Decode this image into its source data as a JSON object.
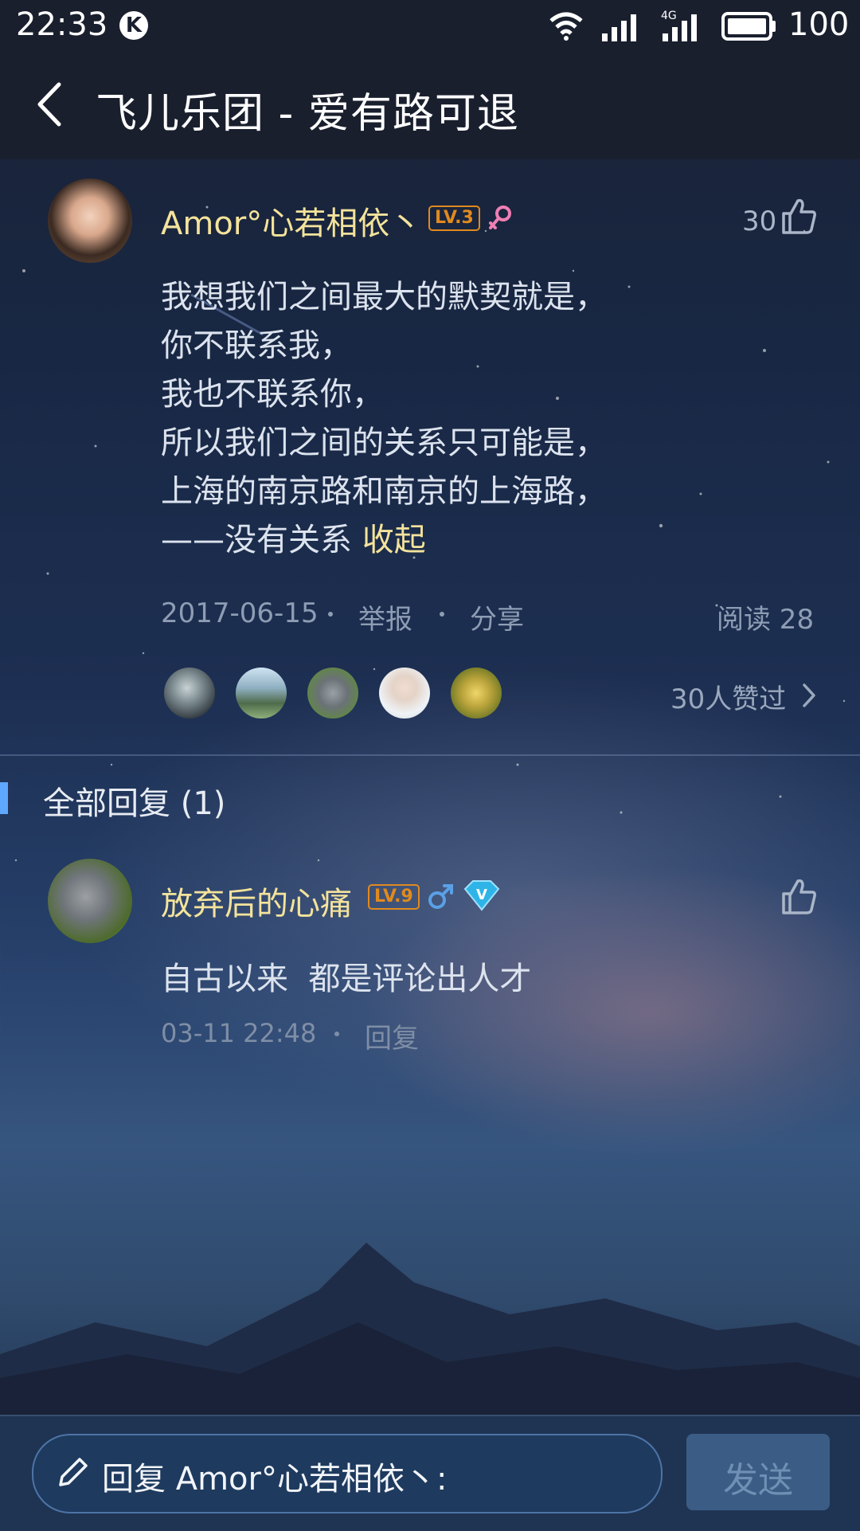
{
  "status_bar": {
    "time": "22:33",
    "app_badge": "K",
    "network": "4G",
    "battery": "100"
  },
  "header": {
    "title": "飞儿乐团 - 爱有路可退"
  },
  "post": {
    "author": "Amor°心若相依丶",
    "level": "LV.3",
    "gender_icon": "female-icon",
    "like_count": "30",
    "lines": [
      "我想我们之间最大的默契就是，",
      "你不联系我，",
      "我也不联系你，",
      "所以我们之间的关系只可能是，",
      "上海的南京路和南京的上海路，",
      "——没有关系"
    ],
    "collapse_label": "收起",
    "date": "2017-06-15",
    "report_label": "举报",
    "share_label": "分享",
    "read_label": "阅读 28",
    "likers_label": "30人赞过"
  },
  "replies": {
    "section_title": "全部回复 (1)",
    "items": [
      {
        "author": "放弃后的心痛",
        "level": "LV.9",
        "gender_icon": "male-icon",
        "vip_badge": "V",
        "text": "自古以来  都是评论出人才",
        "time": "03-11 22:48",
        "reply_label": "回复"
      }
    ]
  },
  "composer": {
    "placeholder": "回复 Amor°心若相依丶:",
    "send_label": "发送"
  },
  "colors": {
    "username": "#f4e39b",
    "level_badge": "#e08a1e",
    "accent_blue": "#5fa8ff",
    "header_bg": "#1a1f2e"
  }
}
